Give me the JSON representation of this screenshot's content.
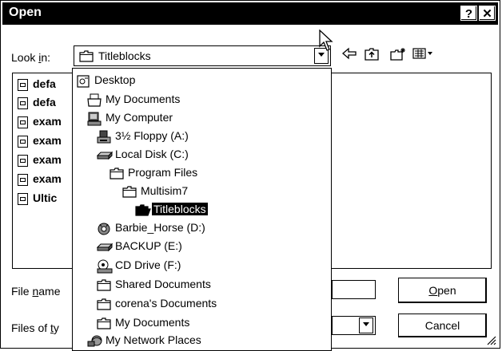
{
  "window": {
    "title": "Open",
    "help_label": "?",
    "close_label": "✕"
  },
  "look_in": {
    "label_pre": "Look ",
    "label_u": "i",
    "label_post": "n:",
    "value": "Titleblocks"
  },
  "toolbar": {
    "icons": [
      "back-arrow-icon",
      "up-folder-icon",
      "new-folder-icon",
      "view-menu-icon"
    ]
  },
  "files": [
    {
      "label": "defa"
    },
    {
      "label": "defa"
    },
    {
      "label": "exam"
    },
    {
      "label": "exam"
    },
    {
      "label": "exam"
    },
    {
      "label": "exam"
    },
    {
      "label": "Ultic"
    }
  ],
  "file_name": {
    "label_pre": "File ",
    "label_u": "n",
    "label_post": "ame"
  },
  "file_type": {
    "label_pre": "Files of ",
    "label_u": "t",
    "label_post": "y"
  },
  "buttons": {
    "open_u": "O",
    "open_rest": "pen",
    "cancel": "Cancel"
  },
  "dropdown": {
    "items": [
      {
        "label": "Desktop",
        "icon": "desktop-icon",
        "indent": 0
      },
      {
        "label": "My Documents",
        "icon": "documents-folder-icon",
        "indent": 1
      },
      {
        "label": "My Computer",
        "icon": "computer-icon",
        "indent": 1
      },
      {
        "label": "3½ Floppy (A:)",
        "icon": "floppy-drive-icon",
        "indent": 2
      },
      {
        "label": "Local Disk (C:)",
        "icon": "hard-disk-icon",
        "indent": 2
      },
      {
        "label": "Program Files",
        "icon": "folder-icon",
        "indent": 3
      },
      {
        "label": "Multisim7",
        "icon": "folder-icon",
        "indent": 4
      },
      {
        "label": "Titleblocks",
        "icon": "open-folder-icon",
        "indent": 5,
        "selected": true
      },
      {
        "label": "Barbie_Horse (D:)",
        "icon": "cd-drive-icon",
        "indent": 2
      },
      {
        "label": "BACKUP (E:)",
        "icon": "network-drive-icon",
        "indent": 2
      },
      {
        "label": "CD Drive (F:)",
        "icon": "cd-drive-icon",
        "indent": 2
      },
      {
        "label": "Shared Documents",
        "icon": "folder-icon",
        "indent": 2
      },
      {
        "label": "corena's Documents",
        "icon": "folder-icon",
        "indent": 2
      },
      {
        "label": "My Documents",
        "icon": "folder-icon",
        "indent": 2
      },
      {
        "label": "My Network Places",
        "icon": "network-places-icon",
        "indent": 1
      }
    ]
  }
}
